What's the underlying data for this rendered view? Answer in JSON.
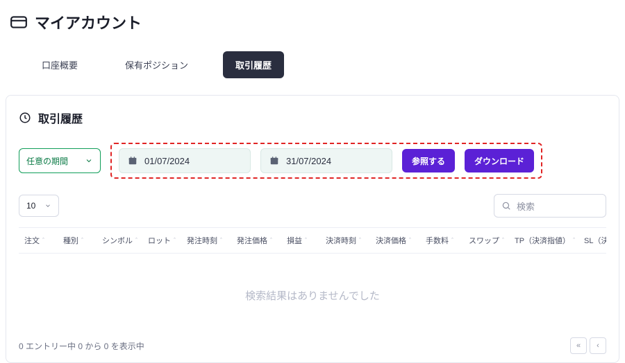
{
  "header": {
    "title": "マイアカウント"
  },
  "tabs": [
    {
      "label": "口座概要"
    },
    {
      "label": "保有ポジション"
    },
    {
      "label": "取引履歴"
    }
  ],
  "panel": {
    "title": "取引履歴",
    "period_select": "任意の期間",
    "date_from": "01/07/2024",
    "date_to": "31/07/2024",
    "btn_query": "参照する",
    "btn_download": "ダウンロード",
    "page_size": "10",
    "search_placeholder": "検索",
    "columns": [
      "注文",
      "種別",
      "シンボル",
      "ロット",
      "発注時刻",
      "発注価格",
      "損益",
      "決済時刻",
      "決済価格",
      "手数料",
      "スワップ",
      "TP（決済指値）",
      "SL（決済"
    ],
    "empty_text": "検索結果はありませんでした",
    "footer_text": "0 エントリー中 0 から 0 を表示中"
  }
}
